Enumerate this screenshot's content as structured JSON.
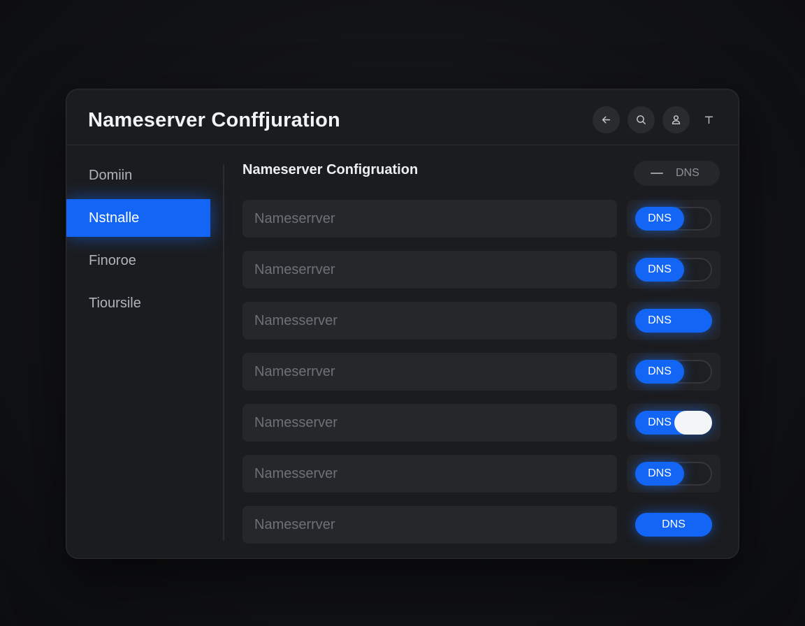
{
  "header": {
    "title": "Nameserver Conffjuration",
    "icons": [
      "back-arrow-icon",
      "search-icon",
      "user-icon",
      "text-icon"
    ]
  },
  "sidebar": {
    "items": [
      {
        "label": "Domiin",
        "active": false
      },
      {
        "label": "Nstnalle",
        "active": true
      },
      {
        "label": "Finoroe",
        "active": false
      },
      {
        "label": "Tioursile",
        "active": false
      }
    ]
  },
  "main": {
    "title": "Nameserver Configruation",
    "dns_pill_label": "DNS",
    "rows": [
      {
        "placeholder": "Nameserrver",
        "toggle_label": "DNS",
        "state": "left"
      },
      {
        "placeholder": "Nameserrver",
        "toggle_label": "DNS",
        "state": "left"
      },
      {
        "placeholder": "Namesserver",
        "toggle_label": "DNS",
        "state": "full"
      },
      {
        "placeholder": "Nameserrver",
        "toggle_label": "DNS",
        "state": "left"
      },
      {
        "placeholder": "Namesserver",
        "toggle_label": "DNS",
        "state": "white-knob"
      },
      {
        "placeholder": "Namesserver",
        "toggle_label": "DNS",
        "state": "left"
      },
      {
        "placeholder": "Nameserrver",
        "toggle_label": "DNS",
        "state": "full-centered"
      }
    ]
  },
  "colors": {
    "accent": "#1366f5",
    "background": "#121316",
    "panel": "#1b1c1f",
    "input": "#26272b"
  }
}
